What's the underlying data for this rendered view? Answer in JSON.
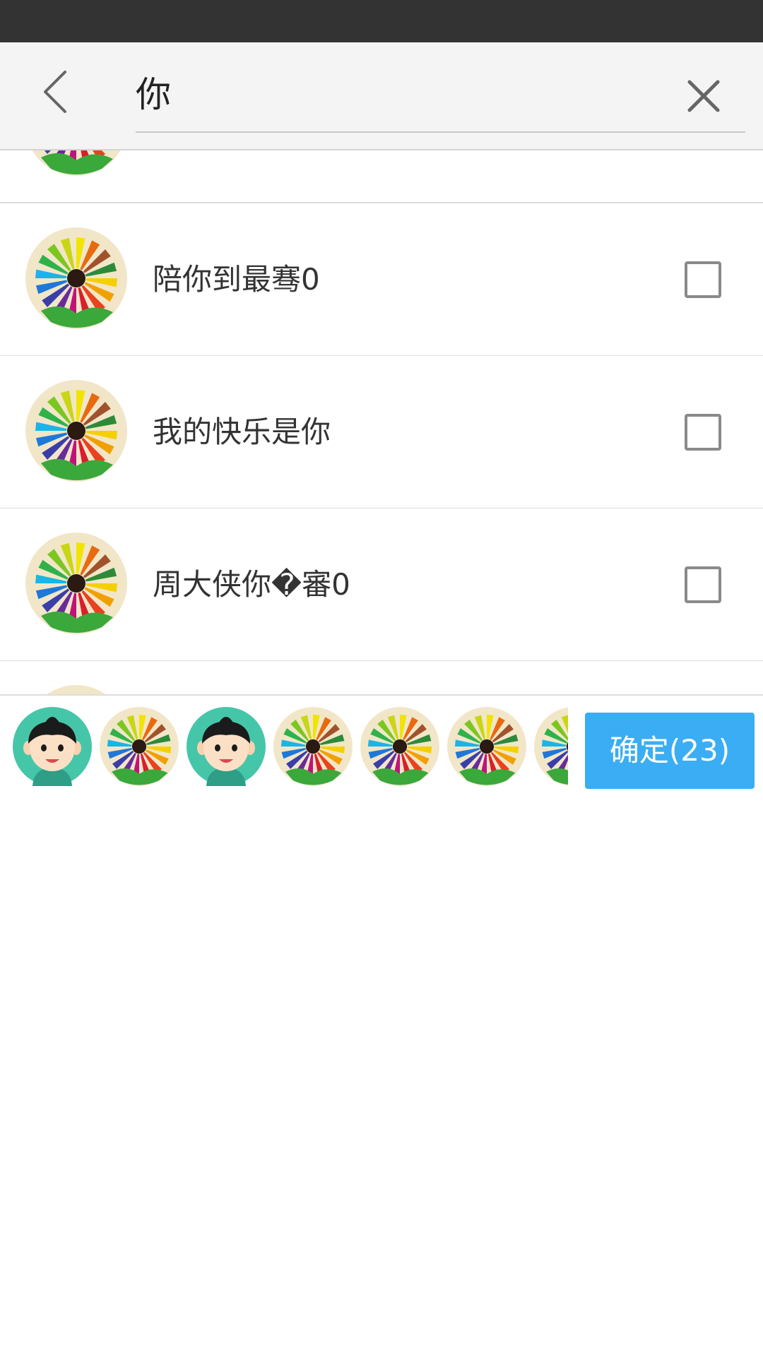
{
  "search": {
    "query": "你",
    "back_icon": "chevron-left-icon",
    "clear_icon": "close-icon"
  },
  "contacts": [
    {
      "name": "",
      "avatar": "color-pencils-avatar",
      "checked": false
    },
    {
      "name": "陪你到最骞0",
      "avatar": "color-pencils-avatar",
      "checked": false
    },
    {
      "name": "我的快乐是你",
      "avatar": "color-pencils-avatar",
      "checked": false
    },
    {
      "name": "周大侠你�審0",
      "avatar": "color-pencils-avatar",
      "checked": false
    },
    {
      "name": "",
      "avatar": "color-pencils-avatar",
      "checked": false
    }
  ],
  "selected": [
    {
      "avatar": "cartoon-boy-avatar"
    },
    {
      "avatar": "color-pencils-avatar"
    },
    {
      "avatar": "cartoon-boy-avatar"
    },
    {
      "avatar": "color-pencils-avatar"
    },
    {
      "avatar": "color-pencils-avatar"
    },
    {
      "avatar": "color-pencils-avatar"
    },
    {
      "avatar": "color-pencils-avatar"
    }
  ],
  "confirm": {
    "label": "确定(23)"
  },
  "colors": {
    "accent": "#3aadf4",
    "status_bar": "#333333",
    "header_bg": "#f4f4f4",
    "avatar_teal": "#46c6a8"
  }
}
